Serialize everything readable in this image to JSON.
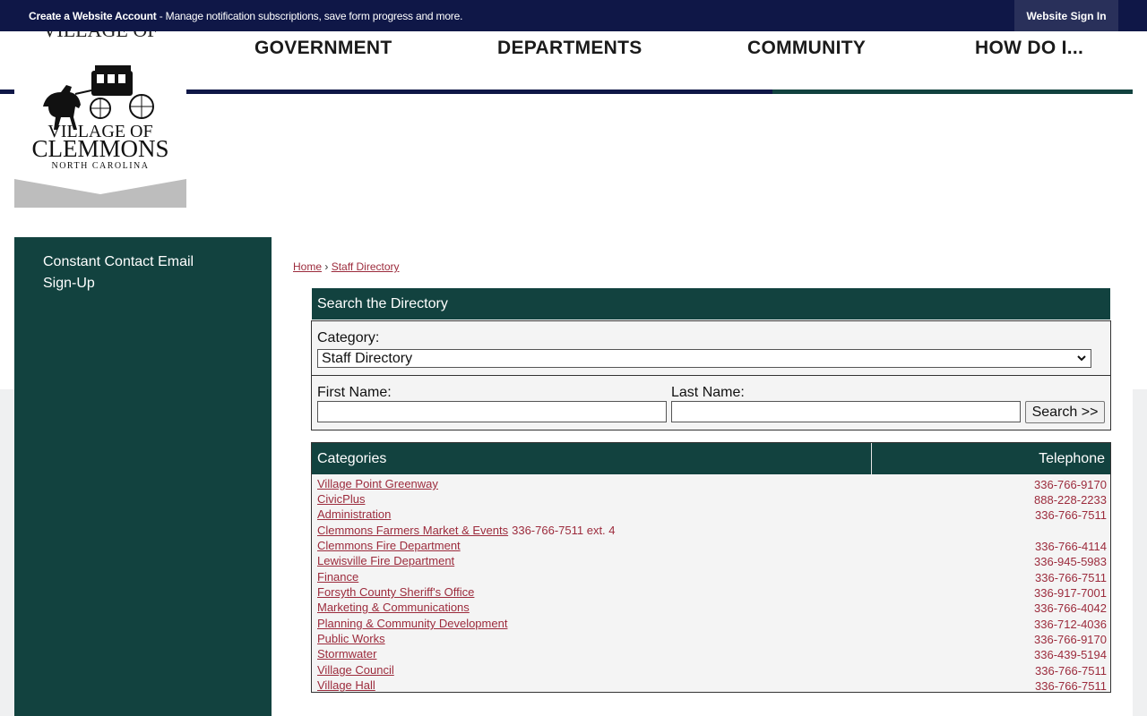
{
  "topbar": {
    "account_link": "Create a Website Account",
    "account_message": " - Manage notification subscriptions, save form progress and more.",
    "signin_label": "Website Sign In"
  },
  "logo": {
    "text_line1": "VILLAGE OF",
    "text_line2": "CLEMMONS",
    "text_line3": "NORTH CAROLINA"
  },
  "nav": {
    "items": [
      "GOVERNMENT",
      "DEPARTMENTS",
      "COMMUNITY",
      "HOW DO I..."
    ]
  },
  "sidebar": {
    "link": "Constant Contact Email Sign-Up"
  },
  "breadcrumb": {
    "home": "Home",
    "separator": "›",
    "current": "Staff Directory"
  },
  "search": {
    "title": "Search the Directory",
    "category_label": "Category:",
    "category_value": "Staff Directory",
    "first_name_label": "First Name:",
    "last_name_label": "Last Name:",
    "first_name_value": "",
    "last_name_value": "",
    "button_label": "Search >>"
  },
  "categories": {
    "header_name": "Categories",
    "header_phone": "Telephone",
    "rows": [
      {
        "name": "Village Point Greenway",
        "phone": "336-766-9170"
      },
      {
        "name": "CivicPlus",
        "phone": "888-228-2233"
      },
      {
        "name": "Administration",
        "phone": "336-766-7511"
      },
      {
        "name": "Clemmons Farmers Market & Events",
        "phone": "336-766-7511 ext. 4",
        "inline": true
      },
      {
        "name": "Clemmons Fire Department",
        "phone": "336-766-4114"
      },
      {
        "name": "Lewisville Fire Department",
        "phone": "336-945-5983"
      },
      {
        "name": "Finance",
        "phone": "336-766-7511"
      },
      {
        "name": "Forsyth County Sheriff's Office",
        "phone": "336-917-7001"
      },
      {
        "name": "Marketing & Communications",
        "phone": "336-766-4042"
      },
      {
        "name": "Planning & Community Development",
        "phone": "336-712-4036"
      },
      {
        "name": "Public Works",
        "phone": "336-766-9170"
      },
      {
        "name": "Stormwater",
        "phone": "336-439-5194"
      },
      {
        "name": "Village Council",
        "phone": "336-766-7511"
      },
      {
        "name": "Village Hall",
        "phone": "336-766-7511"
      }
    ]
  },
  "colors": {
    "navy": "#0f1747",
    "teal": "#12423f",
    "link": "#9c2b3c",
    "panel": "#f4f4f4"
  }
}
